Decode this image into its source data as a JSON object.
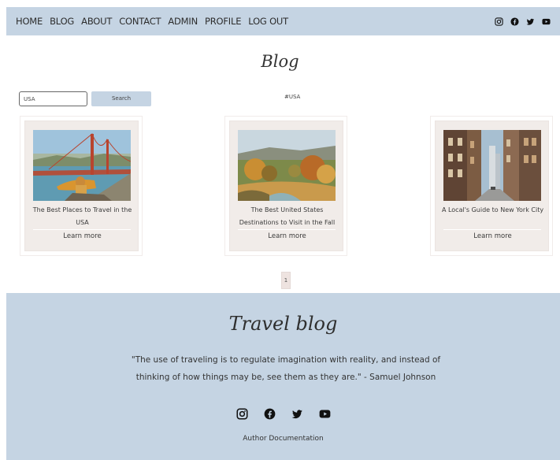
{
  "nav": {
    "links": [
      "HOME",
      "BLOG",
      "ABOUT",
      "CONTACT",
      "ADMIN",
      "PROFILE",
      "LOG OUT"
    ],
    "social_icons": [
      "instagram-icon",
      "facebook-icon",
      "twitter-icon",
      "youtube-icon"
    ]
  },
  "page": {
    "title": "Blog"
  },
  "search": {
    "value": "USA",
    "button_label": "Search",
    "tag": "#USA"
  },
  "posts": [
    {
      "title": "The Best Places to Travel in the USA",
      "link_label": "Learn more",
      "image": "golden-gate-bridge"
    },
    {
      "title": "The Best United States Destinations to Visit in the Fall",
      "link_label": "Learn more",
      "image": "autumn-landscape"
    },
    {
      "title": "A Local's Guide to New York City",
      "link_label": "Learn more",
      "image": "new-york-street"
    }
  ],
  "pagination": {
    "current": "1"
  },
  "footer": {
    "title": "Travel blog",
    "quote": "\"The use of traveling is to regulate imagination with reality, and instead of thinking of how things may be, see them as they are.\" - Samuel Johnson",
    "social_icons": [
      "instagram-icon",
      "facebook-icon",
      "twitter-icon",
      "youtube-icon"
    ],
    "doc_link": "Author Documentation"
  },
  "colors": {
    "accent": "#c5d4e3",
    "card_bg": "#f1ece9"
  }
}
